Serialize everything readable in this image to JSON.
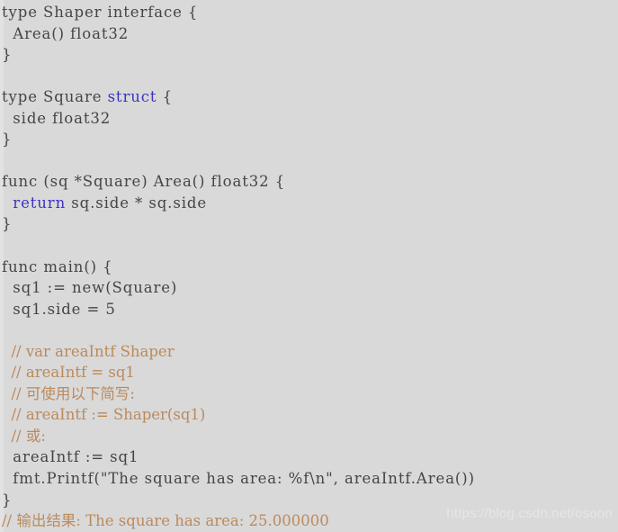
{
  "editor": {
    "background_color": "#d9d9d9",
    "code_color": "#454545",
    "keyword_color": "#3a33c4",
    "comment_color": "#bb8a5c",
    "watermark_color": "#e6e6e6",
    "language": "go"
  },
  "lines": [
    {
      "id": "l1",
      "kind": "code",
      "text": "type Shaper interface {"
    },
    {
      "id": "l2",
      "kind": "code",
      "text": "  Area() float32"
    },
    {
      "id": "l3",
      "kind": "code",
      "text": "}"
    },
    {
      "id": "l4",
      "kind": "blank",
      "text": ""
    },
    {
      "id": "l5",
      "kind": "code",
      "text": "type Square ",
      "keyword": "struct",
      "tail": " {"
    },
    {
      "id": "l6",
      "kind": "code",
      "text": "  side float32"
    },
    {
      "id": "l7",
      "kind": "code",
      "text": "}"
    },
    {
      "id": "l8",
      "kind": "blank",
      "text": ""
    },
    {
      "id": "l9",
      "kind": "code",
      "text": "func (sq *Square) Area() float32 {"
    },
    {
      "id": "l10",
      "kind": "code",
      "text": "  ",
      "keyword": "return",
      "tail": " sq.side * sq.side"
    },
    {
      "id": "l11",
      "kind": "code",
      "text": "}"
    },
    {
      "id": "l12",
      "kind": "blank",
      "text": ""
    },
    {
      "id": "l13",
      "kind": "code",
      "text": "func main() {"
    },
    {
      "id": "l14",
      "kind": "code",
      "text": "  sq1 := new(Square)"
    },
    {
      "id": "l15",
      "kind": "code",
      "text": "  sq1.side = 5"
    },
    {
      "id": "l16",
      "kind": "blank",
      "text": ""
    },
    {
      "id": "l17",
      "kind": "comment",
      "text": "  // var areaIntf Shaper"
    },
    {
      "id": "l18",
      "kind": "comment",
      "text": "  // areaIntf = sq1"
    },
    {
      "id": "l19",
      "kind": "comment",
      "text": "  // 可使用以下简写:"
    },
    {
      "id": "l20",
      "kind": "comment",
      "text": "  // areaIntf := Shaper(sq1)"
    },
    {
      "id": "l21",
      "kind": "comment",
      "text": "  // 或:"
    },
    {
      "id": "l22",
      "kind": "code",
      "text": "  areaIntf := sq1"
    },
    {
      "id": "l23",
      "kind": "code",
      "text": "  fmt.Printf(\"The square has area: %f\\n\", areaIntf.Area())"
    },
    {
      "id": "l24",
      "kind": "code",
      "text": "}"
    },
    {
      "id": "l25",
      "kind": "comment",
      "text": "// 输出结果: The square has area: 25.000000"
    }
  ],
  "watermark": {
    "text": "https://blog.csdn.net/osoon"
  }
}
